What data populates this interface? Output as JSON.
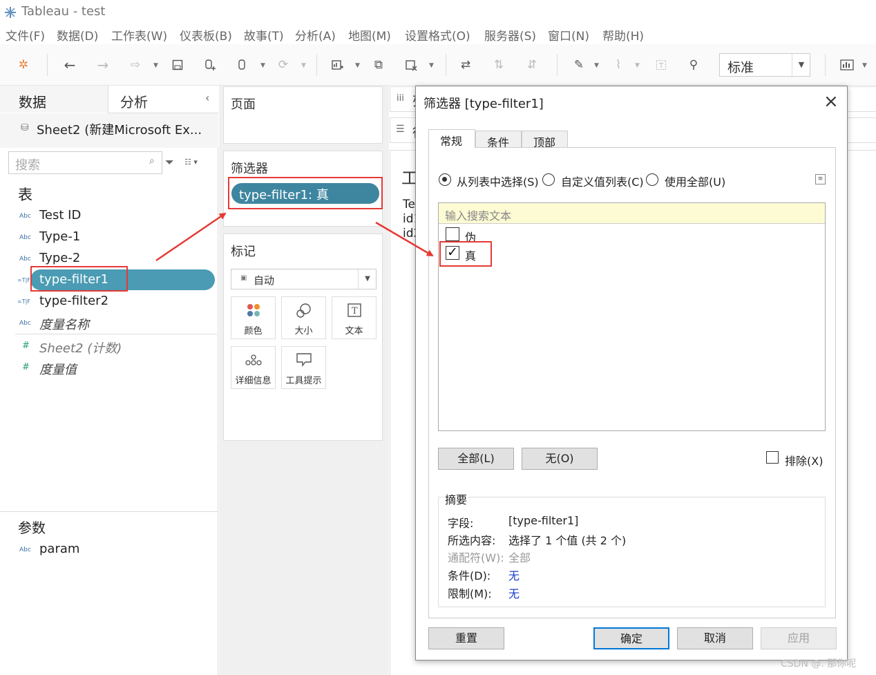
{
  "window": {
    "title": "Tableau - test"
  },
  "menu": [
    "文件(F)",
    "数据(D)",
    "工作表(W)",
    "仪表板(B)",
    "故事(T)",
    "分析(A)",
    "地图(M)",
    "设置格式(O)",
    "服务器(S)",
    "窗口(N)",
    "帮助(H)"
  ],
  "toolbar": {
    "view_select": "标准"
  },
  "left_pane": {
    "tab_data": "数据",
    "tab_analysis": "分析",
    "datasource": "Sheet2 (新建Microsoft Ex...",
    "search_placeholder": "搜索",
    "tables_header": "表",
    "fields": [
      {
        "type": "Abc",
        "name": "Test ID"
      },
      {
        "type": "Abc",
        "name": "Type-1"
      },
      {
        "type": "Abc",
        "name": "Type-2"
      },
      {
        "type": "=T|F",
        "name": "type-filter1"
      },
      {
        "type": "=T|F",
        "name": "type-filter2"
      },
      {
        "type": "Abc",
        "name": "度量名称"
      },
      {
        "type": "#",
        "name": "Sheet2 (计数)"
      },
      {
        "type": "#",
        "name": "度量值"
      }
    ],
    "params_header": "参数",
    "params": [
      {
        "type": "Abc",
        "name": "param"
      }
    ]
  },
  "shelves": {
    "pages": "页面",
    "filters": "筛选器",
    "filter_pill": "type-filter1: 真",
    "marks": "标记",
    "marks_type": "自动",
    "mark_buttons": [
      "颜色",
      "大小",
      "文本",
      "详细信息",
      "工具提示"
    ],
    "columns_icon": "iii",
    "rows_icon": "☰",
    "columns_partial": "列",
    "rows_partial": "行",
    "sheet_partial": "工",
    "sheet_lines": [
      "Te",
      "id1",
      "id2"
    ]
  },
  "dialog": {
    "title": "筛选器 [type-filter1]",
    "tabs": [
      "常规",
      "条件",
      "顶部"
    ],
    "radio_options": [
      "从列表中选择(S)",
      "自定义值列表(C)",
      "使用全部(U)"
    ],
    "search_placeholder": "输入搜索文本",
    "values": [
      {
        "label": "伪",
        "checked": false
      },
      {
        "label": "真",
        "checked": true
      }
    ],
    "btn_all": "全部(L)",
    "btn_none": "无(O)",
    "exclude": "排除(X)",
    "summary_title": "摘要",
    "summary": [
      {
        "k": "字段:",
        "v": "[type-filter1]"
      },
      {
        "k": "所选内容:",
        "v": "选择了 1 个值 (共 2 个)"
      },
      {
        "k": "通配符(W):",
        "v": "全部"
      },
      {
        "k": "条件(D):",
        "v": "无"
      },
      {
        "k": "限制(M):",
        "v": "无"
      }
    ],
    "btn_reset": "重置",
    "btn_ok": "确定",
    "btn_cancel": "取消",
    "btn_apply": "应用"
  },
  "watermark": "CSDN @. 那你呢",
  "colors": {
    "pill": "#3e86a0",
    "highlight_pill": "#4a9bb3",
    "annotation": "#e53935",
    "link_blue": "#1a3ec9"
  }
}
